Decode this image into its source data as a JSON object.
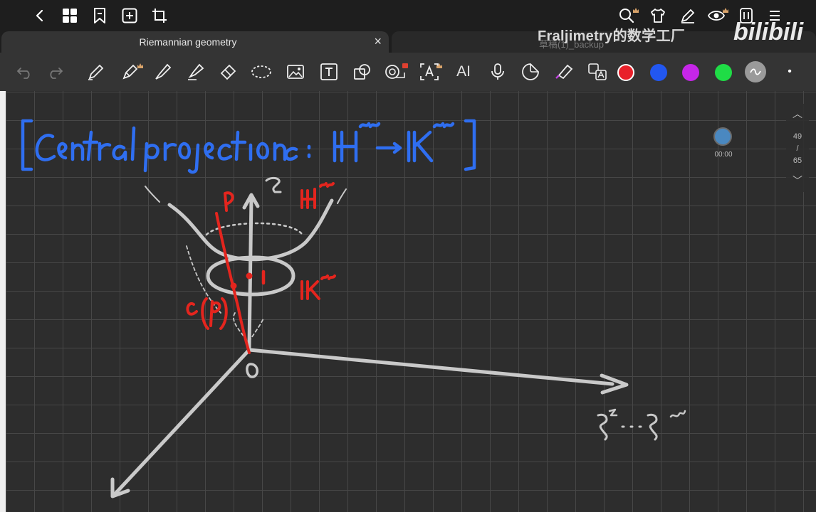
{
  "tabs": {
    "active_title": "Riemannian geometry",
    "inactive_title": "草稿(1)_backup",
    "close_label": "×"
  },
  "watermark": {
    "channel": "Fraljimetry的数学工厂",
    "logo": "bilibili"
  },
  "toolbar": {
    "ai_label": "AI",
    "colors": [
      "#e8202a",
      "#2257f0",
      "#c626e8",
      "#1fdc46",
      "#9a9a9a"
    ],
    "dot": "•"
  },
  "pager": {
    "up": "︿",
    "current": "49",
    "separator": "/",
    "total": "65",
    "down": "﹀"
  },
  "recording": {
    "time": "00:00"
  },
  "icons": {
    "back": "chevron-left-icon",
    "grid": "grid-icon",
    "bookmark": "bookmark-icon",
    "add": "add-page-icon",
    "crop": "crop-icon",
    "search": "search-icon",
    "shirt": "theme-icon",
    "pen": "pen-icon",
    "eye": "eye-icon",
    "phone": "phone-icon",
    "menu": "more-icon"
  }
}
